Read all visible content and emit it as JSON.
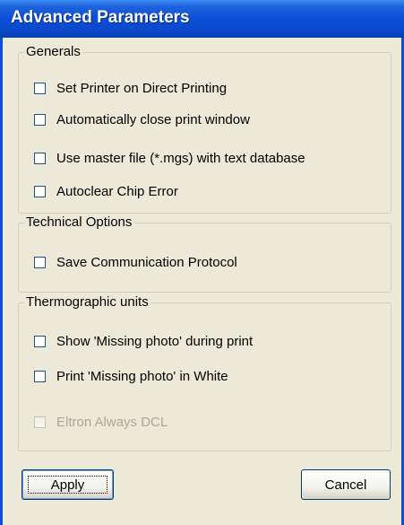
{
  "window": {
    "title": "Advanced Parameters"
  },
  "groups": {
    "generals": {
      "label": "Generals",
      "options": [
        {
          "label": "Set Printer on Direct Printing",
          "checked": false,
          "enabled": true
        },
        {
          "label": "Automatically close print window",
          "checked": false,
          "enabled": true
        },
        {
          "label": "Use master file (*.mgs) with text database",
          "checked": false,
          "enabled": true
        },
        {
          "label": "Autoclear Chip Error",
          "checked": false,
          "enabled": true
        }
      ]
    },
    "technical": {
      "label": "Technical Options",
      "options": [
        {
          "label": "Save Communication Protocol",
          "checked": false,
          "enabled": true
        }
      ]
    },
    "thermographic": {
      "label": "Thermographic units",
      "options": [
        {
          "label": "Show 'Missing photo' during print",
          "checked": false,
          "enabled": true
        },
        {
          "label": "Print 'Missing photo' in White",
          "checked": false,
          "enabled": true
        },
        {
          "label": "Eltron Always DCL",
          "checked": false,
          "enabled": false
        }
      ]
    }
  },
  "buttons": {
    "apply": "Apply",
    "cancel": "Cancel"
  },
  "colors": {
    "title_bar": "#0a4fd6",
    "dialog_bg": "#ece9d8",
    "disabled_text": "#aca899"
  }
}
